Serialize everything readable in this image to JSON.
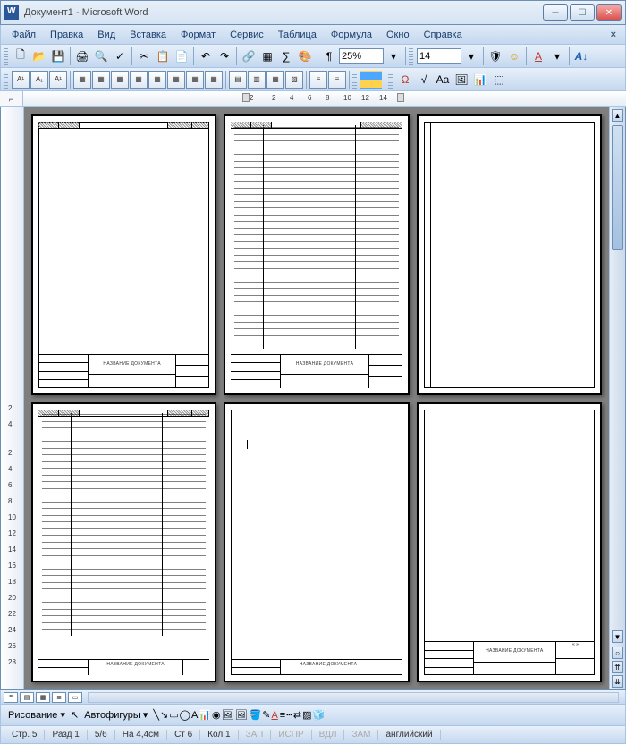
{
  "title": "Документ1 - Microsoft Word",
  "menu": [
    "Файл",
    "Правка",
    "Вид",
    "Вставка",
    "Формат",
    "Сервис",
    "Таблица",
    "Формула",
    "Окно",
    "Справка"
  ],
  "zoom": "25%",
  "fontsize": "14",
  "ruler_h": [
    "2",
    "2",
    "4",
    "6",
    "8",
    "10",
    "12",
    "14"
  ],
  "ruler_v": [
    "2",
    "4",
    "2",
    "4",
    "6",
    "8",
    "10",
    "12",
    "14",
    "16",
    "18",
    "20",
    "22",
    "24",
    "26",
    "28"
  ],
  "stamp_label": "НАЗВАНИЕ ДОКУМЕНТА",
  "draw": {
    "label": "Рисование",
    "autoshapes": "Автофигуры"
  },
  "status": {
    "page": "Стр. 5",
    "section": "Разд 1",
    "pages": "5/6",
    "pos": "На 4,4см",
    "line": "Ст 6",
    "col": "Кол 1",
    "rec": "ЗАП",
    "trk": "ИСПР",
    "ext": "ВДЛ",
    "ovr": "ЗАМ",
    "lang": "английский"
  },
  "icons": {
    "new": "🗋",
    "open": "📂",
    "save": "💾",
    "print": "🖨",
    "preview": "🔍",
    "spell": "✓",
    "cut": "✂",
    "copy": "📋",
    "paste": "📄",
    "undo": "↶",
    "redo": "↷",
    "link": "🔗",
    "table": "▦",
    "para": "¶",
    "omega": "Ω",
    "calc": "∑",
    "gear": "⚙",
    "palette": "🎨",
    "shield": "🛡",
    "letter": "Aа",
    "highlight": "ab",
    "fontcolor": "A",
    "arrow": "↘",
    "line": "╲",
    "rect": "▭",
    "oval": "◯",
    "text": "A",
    "wordart": "📊",
    "clip": "🖼",
    "fill": "🪣",
    "linecolor": "✎",
    "shadow": "▨",
    "3d": "🧊"
  }
}
